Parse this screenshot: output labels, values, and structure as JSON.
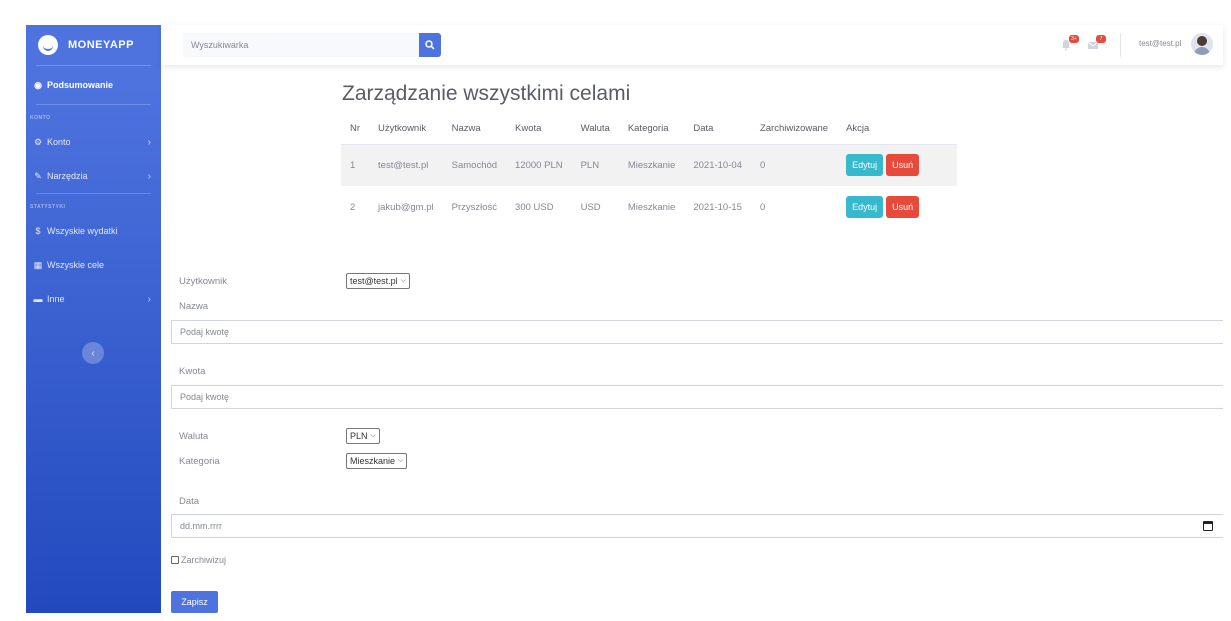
{
  "app": {
    "brand": "MONEYAPP"
  },
  "topbar": {
    "search_placeholder": "Wyszukiwarka",
    "alerts_count": "3+",
    "messages_count": "7",
    "user_email": "test@test.pl"
  },
  "sidebar": {
    "dashboard": "Podsumowanie",
    "heading_account": "KONTO",
    "account": "Konto",
    "tools": "Narzędzia",
    "heading_stats": "STATYSTYKI",
    "all_expenses": "Wszyskie wydatki",
    "all_goals": "Wszyskie cele",
    "other": "Inne"
  },
  "main": {
    "title": "Zarządzanie wszystkimi celami",
    "table": {
      "headers": [
        "Nr",
        "Użytkownik",
        "Nazwa",
        "Kwota",
        "Waluta",
        "Kategoria",
        "Data",
        "Zarchiwizowane",
        "Akcja"
      ],
      "rows": [
        [
          "1",
          "test@test.pl",
          "Samochód",
          "12000 PLN",
          "PLN",
          "Mieszkanie",
          "2021-10-04",
          "0"
        ],
        [
          "2",
          "jakub@gm.pl",
          "Przyszłość",
          "300 USD",
          "USD",
          "Mieszkanie",
          "2021-10-15",
          "0"
        ]
      ],
      "edit_label": "Edytuj",
      "delete_label": "Usuń"
    }
  },
  "form": {
    "user_label": "Użytkownik",
    "user_value": "test@test.pl",
    "name_label": "Nazwa",
    "name_placeholder": "Podaj kwotę",
    "amount_label": "Kwota",
    "amount_placeholder": "Podaj kwotę",
    "currency_label": "Waluta",
    "currency_value": "PLN",
    "category_label": "Kategoria",
    "category_value": "Mieszkanie",
    "date_label": "Data",
    "date_placeholder": "dd.mm.rrrr",
    "archive_label": "Zarchiwizuj",
    "save_label": "Zapisz"
  },
  "colors": {
    "primary": "#4e73df",
    "info": "#36b9cc",
    "danger": "#e74a3b"
  },
  "icons": {
    "dashboard": "tachometer-icon",
    "account": "gear-icon",
    "tools": "wrench-icon",
    "expenses": "dollar-icon",
    "goals": "table-icon",
    "other": "folder-icon",
    "search": "search-icon",
    "alerts": "bell-icon",
    "messages": "envelope-icon",
    "calendar": "calendar-icon"
  }
}
